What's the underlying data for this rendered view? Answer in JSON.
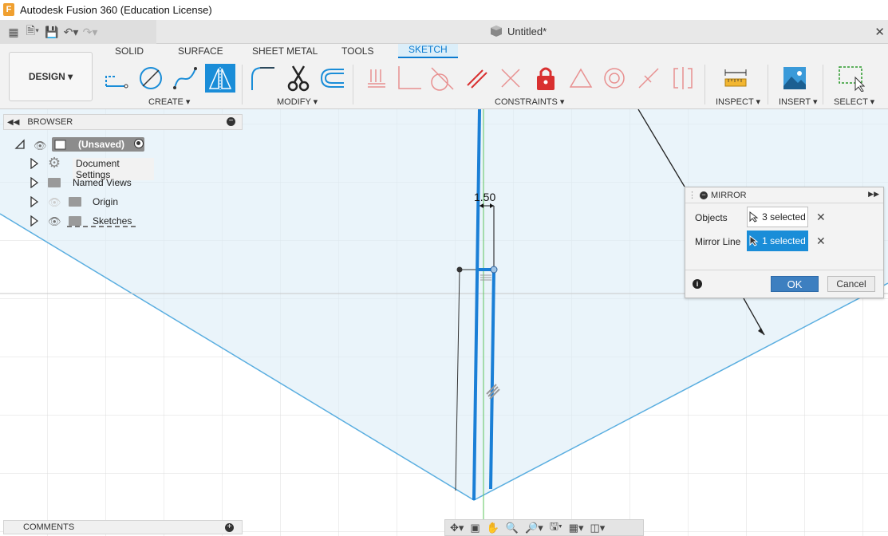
{
  "window": {
    "title": "Autodesk Fusion 360 (Education License)",
    "logo": "F"
  },
  "document": {
    "name": "Untitled*"
  },
  "ribbon": {
    "workspace": "DESIGN",
    "tabs": [
      "SOLID",
      "SURFACE",
      "SHEET METAL",
      "TOOLS",
      "SKETCH"
    ],
    "active_tab": "SKETCH",
    "groups": [
      "CREATE",
      "MODIFY",
      "CONSTRAINTS",
      "INSPECT",
      "INSERT",
      "SELECT"
    ],
    "accent_color": "#1a8dd8",
    "constraint_color": "#e03c3c"
  },
  "browser": {
    "title": "BROWSER",
    "root": "(Unsaved)",
    "items": [
      "Document Settings",
      "Named Views",
      "Origin",
      "Sketches"
    ]
  },
  "comments": {
    "title": "COMMENTS"
  },
  "sketch": {
    "dimension_label": "1.50"
  },
  "mirror_dialog": {
    "title": "MIRROR",
    "objects_label": "Objects",
    "objects_value": "3 selected",
    "mirror_line_label": "Mirror Line",
    "mirror_line_value": "1 selected",
    "ok": "OK",
    "cancel": "Cancel"
  }
}
